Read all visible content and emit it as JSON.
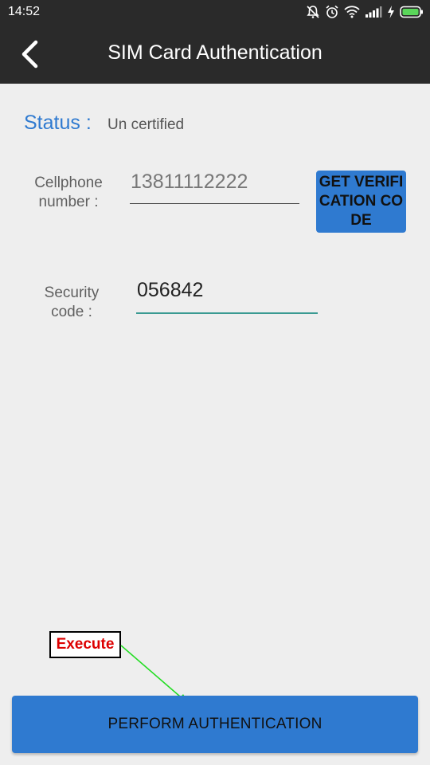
{
  "statusbar": {
    "time": "14:52",
    "icons": [
      "mute-icon",
      "alarm-icon",
      "wifi-icon",
      "signal-icon",
      "charging-icon",
      "battery-icon"
    ]
  },
  "appbar": {
    "title": "SIM Card Authentication",
    "back_icon": "back-arrow-icon"
  },
  "status": {
    "label": "Status :",
    "value": "Un certified"
  },
  "cellphone": {
    "label": "Cellphone number :",
    "value": "13811112222",
    "button_label": "GET VERIFICATION CODE"
  },
  "security": {
    "label": "Security code :",
    "value": "056842"
  },
  "annotation": {
    "label": "Execute"
  },
  "perform_button": {
    "label": "PERFORM AUTHENTICATION"
  },
  "colors": {
    "primary": "#2f7ad0",
    "appbar": "#2a2a2a",
    "background": "#eeeeee",
    "accent_underline": "#3a9a92",
    "annotation_text": "#dd0000",
    "annotation_arrow": "#22dd22"
  }
}
